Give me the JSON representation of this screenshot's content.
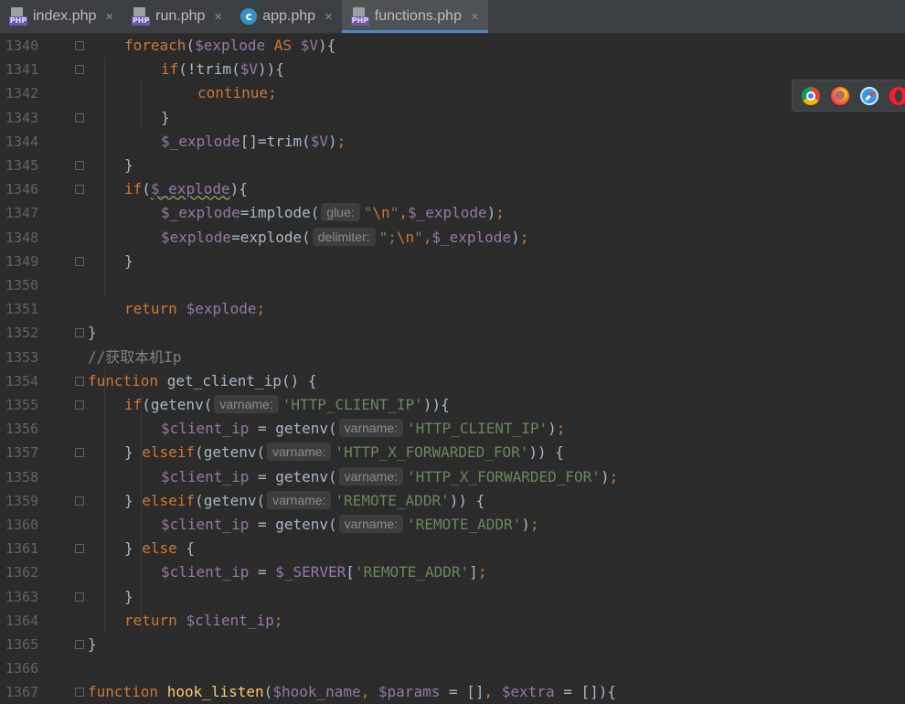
{
  "tabs": [
    {
      "label": "index.php",
      "icon": "php-file-icon"
    },
    {
      "label": "run.php",
      "icon": "php-file-icon"
    },
    {
      "label": "app.php",
      "icon": "c-class-icon"
    },
    {
      "label": "functions.php",
      "icon": "php-file-icon",
      "active": true
    }
  ],
  "tab_icon_label": "PHP",
  "tab_close_glyph": "×",
  "app_icon_letter": "c",
  "browsers": [
    "chrome-icon",
    "firefox-icon",
    "safari-icon",
    "opera-icon"
  ],
  "colors": {
    "background": "#2b2b2b",
    "keyword": "#cc7832",
    "variable": "#9876aa",
    "string": "#6a8759",
    "function": "#ffc66d",
    "comment": "#808080",
    "active_tab_underline": "#4a88c7"
  },
  "lines": [
    {
      "n": "1340",
      "indent": 1,
      "fold": true,
      "tokens": [
        [
          "kw",
          "foreach"
        ],
        [
          "p",
          "("
        ],
        [
          "var",
          "$explode"
        ],
        [
          "p",
          " "
        ],
        [
          "kw",
          "AS"
        ],
        [
          "p",
          " "
        ],
        [
          "var",
          "$V"
        ],
        [
          "p",
          "){"
        ]
      ]
    },
    {
      "n": "1341",
      "indent": 2,
      "fold": true,
      "tokens": [
        [
          "kw",
          "if"
        ],
        [
          "p",
          "(!"
        ],
        [
          "p",
          "trim"
        ],
        [
          "p",
          "("
        ],
        [
          "var",
          "$V"
        ],
        [
          "p",
          ")){"
        ]
      ]
    },
    {
      "n": "1342",
      "indent": 3,
      "fold": false,
      "tokens": [
        [
          "kw",
          "continue"
        ],
        [
          "kw",
          ";"
        ]
      ]
    },
    {
      "n": "1343",
      "indent": 2,
      "fold": true,
      "tokens": [
        [
          "p",
          "}"
        ]
      ]
    },
    {
      "n": "1344",
      "indent": 2,
      "fold": false,
      "tokens": [
        [
          "var",
          "$_explode"
        ],
        [
          "p",
          "[]=trim("
        ],
        [
          "var",
          "$V"
        ],
        [
          "p",
          ")"
        ],
        [
          "kw",
          ";"
        ]
      ]
    },
    {
      "n": "1345",
      "indent": 1,
      "fold": true,
      "tokens": [
        [
          "p",
          "}"
        ]
      ]
    },
    {
      "n": "1346",
      "indent": 1,
      "fold": true,
      "tokens": [
        [
          "kw",
          "if"
        ],
        [
          "p",
          "("
        ],
        [
          "varsq",
          "$_explode"
        ],
        [
          "p",
          "){"
        ]
      ]
    },
    {
      "n": "1347",
      "indent": 2,
      "fold": false,
      "tokens": [
        [
          "var",
          "$_explode"
        ],
        [
          "p",
          "=implode("
        ],
        [
          "hint",
          "glue:"
        ],
        [
          "str",
          "\""
        ],
        [
          "esc",
          "\\n"
        ],
        [
          "str",
          "\""
        ],
        [
          "kw",
          ","
        ],
        [
          "var",
          "$_explode"
        ],
        [
          "p",
          ")"
        ],
        [
          "kw",
          ";"
        ]
      ]
    },
    {
      "n": "1348",
      "indent": 2,
      "fold": false,
      "tokens": [
        [
          "var",
          "$explode"
        ],
        [
          "p",
          "=explode("
        ],
        [
          "hint",
          "delimiter:"
        ],
        [
          "str",
          "\";"
        ],
        [
          "esc",
          "\\n"
        ],
        [
          "str",
          "\""
        ],
        [
          "kw",
          ","
        ],
        [
          "var",
          "$_explode"
        ],
        [
          "p",
          ")"
        ],
        [
          "kw",
          ";"
        ]
      ]
    },
    {
      "n": "1349",
      "indent": 1,
      "fold": true,
      "tokens": [
        [
          "p",
          "}"
        ]
      ]
    },
    {
      "n": "1350",
      "indent": 0,
      "fold": false,
      "tokens": []
    },
    {
      "n": "1351",
      "indent": 1,
      "fold": false,
      "tokens": [
        [
          "kw",
          "return"
        ],
        [
          "p",
          " "
        ],
        [
          "var",
          "$explode"
        ],
        [
          "kw",
          ";"
        ]
      ]
    },
    {
      "n": "1352",
      "indent": 0,
      "fold": true,
      "tokens": [
        [
          "p",
          "}"
        ]
      ]
    },
    {
      "n": "1353",
      "indent": 0,
      "fold": false,
      "tokens": [
        [
          "cmt",
          "//获取本机Ip"
        ]
      ]
    },
    {
      "n": "1354",
      "indent": 0,
      "fold": true,
      "tokens": [
        [
          "kw",
          "function"
        ],
        [
          "p",
          " "
        ],
        [
          "p",
          "get_client_ip"
        ],
        [
          "p",
          "() {"
        ]
      ]
    },
    {
      "n": "1355",
      "indent": 1,
      "fold": true,
      "tokens": [
        [
          "kw",
          "if"
        ],
        [
          "p",
          "(getenv("
        ],
        [
          "hint",
          "varname:"
        ],
        [
          "str",
          "'HTTP_CLIENT_IP'"
        ],
        [
          "p",
          "))"
        ],
        [
          "p",
          "{"
        ]
      ]
    },
    {
      "n": "1356",
      "indent": 2,
      "fold": false,
      "tokens": [
        [
          "var",
          "$client_ip"
        ],
        [
          "p",
          " = getenv("
        ],
        [
          "hint",
          "varname:"
        ],
        [
          "str",
          "'HTTP_CLIENT_IP'"
        ],
        [
          "p",
          ")"
        ],
        [
          "kw",
          ";"
        ]
      ]
    },
    {
      "n": "1357",
      "indent": 1,
      "fold": true,
      "tokens": [
        [
          "p",
          "} "
        ],
        [
          "kw",
          "elseif"
        ],
        [
          "p",
          "(getenv("
        ],
        [
          "hint",
          "varname:"
        ],
        [
          "str",
          "'HTTP_X_FORWARDED_FOR'"
        ],
        [
          "p",
          ")) {"
        ]
      ]
    },
    {
      "n": "1358",
      "indent": 2,
      "fold": false,
      "tokens": [
        [
          "var",
          "$client_ip"
        ],
        [
          "p",
          " = getenv("
        ],
        [
          "hint",
          "varname:"
        ],
        [
          "str",
          "'HTTP_X_FORWARDED_FOR'"
        ],
        [
          "p",
          ")"
        ],
        [
          "kw",
          ";"
        ]
      ]
    },
    {
      "n": "1359",
      "indent": 1,
      "fold": true,
      "tokens": [
        [
          "p",
          "} "
        ],
        [
          "kw",
          "elseif"
        ],
        [
          "p",
          "(getenv("
        ],
        [
          "hint",
          "varname:"
        ],
        [
          "str",
          "'REMOTE_ADDR'"
        ],
        [
          "p",
          ")) {"
        ]
      ]
    },
    {
      "n": "1360",
      "indent": 2,
      "fold": false,
      "tokens": [
        [
          "var",
          "$client_ip"
        ],
        [
          "p",
          " = getenv("
        ],
        [
          "hint",
          "varname:"
        ],
        [
          "str",
          "'REMOTE_ADDR'"
        ],
        [
          "p",
          ")"
        ],
        [
          "kw",
          ";"
        ]
      ]
    },
    {
      "n": "1361",
      "indent": 1,
      "fold": true,
      "tokens": [
        [
          "p",
          "} "
        ],
        [
          "kw",
          "else"
        ],
        [
          "p",
          " {"
        ]
      ]
    },
    {
      "n": "1362",
      "indent": 2,
      "fold": false,
      "tokens": [
        [
          "var",
          "$client_ip"
        ],
        [
          "p",
          " = "
        ],
        [
          "var",
          "$_SERVER"
        ],
        [
          "p",
          "["
        ],
        [
          "str",
          "'REMOTE_ADDR'"
        ],
        [
          "p",
          "]"
        ],
        [
          "kw",
          ";"
        ]
      ]
    },
    {
      "n": "1363",
      "indent": 1,
      "fold": true,
      "tokens": [
        [
          "p",
          "}"
        ]
      ]
    },
    {
      "n": "1364",
      "indent": 1,
      "fold": false,
      "tokens": [
        [
          "kw",
          "return"
        ],
        [
          "p",
          " "
        ],
        [
          "var",
          "$client_ip"
        ],
        [
          "kw",
          ";"
        ]
      ]
    },
    {
      "n": "1365",
      "indent": 0,
      "fold": true,
      "tokens": [
        [
          "p",
          "}"
        ]
      ]
    },
    {
      "n": "1366",
      "indent": 0,
      "fold": false,
      "tokens": []
    },
    {
      "n": "1367",
      "indent": 0,
      "fold": true,
      "tokens": [
        [
          "kw",
          "function"
        ],
        [
          "p",
          " "
        ],
        [
          "fn",
          "hook_listen"
        ],
        [
          "p",
          "("
        ],
        [
          "var",
          "$hook_name"
        ],
        [
          "kw",
          ", "
        ],
        [
          "var",
          "$params"
        ],
        [
          "p",
          " = []"
        ],
        [
          "kw",
          ", "
        ],
        [
          "var",
          "$extra"
        ],
        [
          "p",
          " = []){"
        ]
      ]
    }
  ]
}
